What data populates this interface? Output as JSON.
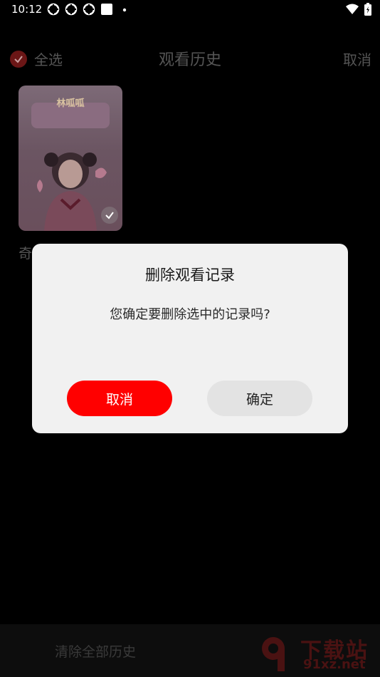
{
  "status_bar": {
    "time": "10:12",
    "icons": [
      "app-icon",
      "app-icon",
      "app-icon",
      "square-icon",
      "dot-icon",
      "wifi-icon",
      "battery-icon"
    ]
  },
  "header": {
    "select_all_label": "全选",
    "title": "观看历史",
    "cancel_label": "取消"
  },
  "history": {
    "items": [
      {
        "poster_title": "林呱呱",
        "caption": "奇",
        "selected": true
      }
    ]
  },
  "bottom_bar": {
    "clear_all_label": "清除全部历史"
  },
  "dialog": {
    "title": "删除观看记录",
    "message": "您确定要删除选中的记录吗?",
    "cancel_label": "取消",
    "confirm_label": "确定"
  },
  "watermark": {
    "text": "下载站",
    "url": "91xz.net"
  },
  "colors": {
    "accent_red": "#ff0000",
    "dialog_bg": "#f1f1f1",
    "confirm_bg": "#e3e3e3"
  }
}
